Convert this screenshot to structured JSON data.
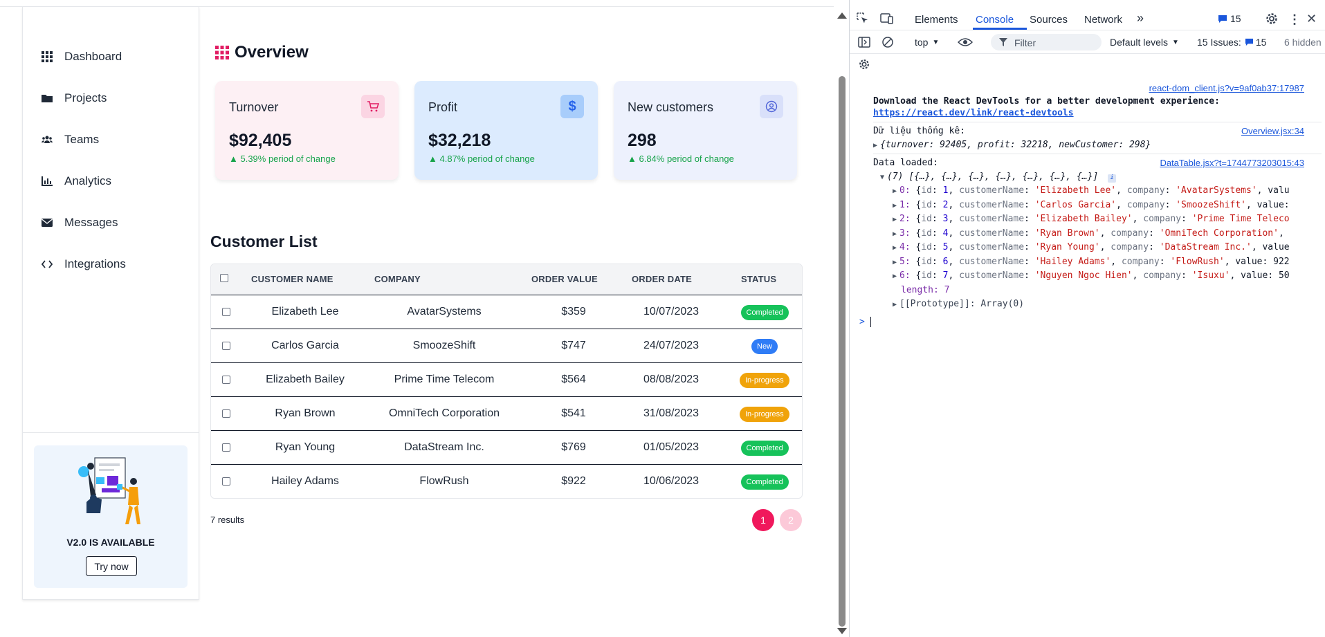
{
  "sidebar": {
    "items": [
      {
        "label": "Dashboard",
        "icon": "grid-icon"
      },
      {
        "label": "Projects",
        "icon": "folder-icon"
      },
      {
        "label": "Teams",
        "icon": "users-icon"
      },
      {
        "label": "Analytics",
        "icon": "chart-icon"
      },
      {
        "label": "Messages",
        "icon": "envelope-icon"
      },
      {
        "label": "Integrations",
        "icon": "code-icon"
      }
    ],
    "promo": {
      "title": "V2.0 IS AVAILABLE",
      "button": "Try now"
    }
  },
  "overview": {
    "title": "Overview",
    "cards": [
      {
        "label": "Turnover",
        "value": "$92,405",
        "change": "▲ 5.39% period of change",
        "icon": "cart-icon",
        "bg": "#fdf0f4",
        "icon_bg": "#fbd5e3",
        "icon_color": "#e11d63"
      },
      {
        "label": "Profit",
        "value": "$32,218",
        "change": "▲ 4.87% period of change",
        "icon": "dollar-icon",
        "bg": "#dcebfe",
        "icon_bg": "#a8cdfb",
        "icon_color": "#2563eb"
      },
      {
        "label": "New customers",
        "value": "298",
        "change": "▲ 6.84% period of change",
        "icon": "user-circle-icon",
        "bg": "#edf1fd",
        "icon_bg": "#d9e0fa",
        "icon_color": "#4f63d8"
      }
    ]
  },
  "customers": {
    "title": "Customer List",
    "columns": [
      "CUSTOMER NAME",
      "COMPANY",
      "ORDER VALUE",
      "ORDER DATE",
      "STATUS"
    ],
    "rows": [
      {
        "name": "Elizabeth Lee",
        "company": "AvatarSystems",
        "value": "$359",
        "date": "10/07/2023",
        "status": "Completed"
      },
      {
        "name": "Carlos Garcia",
        "company": "SmoozeShift",
        "value": "$747",
        "date": "24/07/2023",
        "status": "New"
      },
      {
        "name": "Elizabeth Bailey",
        "company": "Prime Time Telecom",
        "value": "$564",
        "date": "08/08/2023",
        "status": "In-progress"
      },
      {
        "name": "Ryan Brown",
        "company": "OmniTech Corporation",
        "value": "$541",
        "date": "31/08/2023",
        "status": "In-progress"
      },
      {
        "name": "Ryan Young",
        "company": "DataStream Inc.",
        "value": "$769",
        "date": "01/05/2023",
        "status": "Completed"
      },
      {
        "name": "Hailey Adams",
        "company": "FlowRush",
        "value": "$922",
        "date": "10/06/2023",
        "status": "Completed"
      }
    ],
    "status_colors": {
      "Completed": "#16c25a",
      "New": "#2f7cf6",
      "In-progress": "#f0a30a"
    },
    "results": "7 results",
    "pages": [
      "1",
      "2"
    ],
    "active_page": "1"
  },
  "devtools": {
    "tabs": [
      "Elements",
      "Console",
      "Sources",
      "Network"
    ],
    "active_tab": "Console",
    "more_tabs": "»",
    "issues_badge": "15",
    "context": "top",
    "filter_placeholder": "Filter",
    "levels": "Default levels",
    "issues_label": "15 Issues:",
    "issues_count": "15",
    "hidden": "6 hidden",
    "messages": {
      "devtools_link": "react-dom_client.js?v=9af0ab37:17987",
      "devtools_text": "Download the React DevTools for a better development experience:",
      "devtools_url": "https://react.dev/link/react-devtools",
      "stats_label": "Dữ liệu thống kê:",
      "stats_link": "Overview.jsx:34",
      "stats_obj": "{turnover: 92405, profit: 32218, newCustomer: 298}",
      "data_label": "Data loaded:",
      "data_link": "DataTable.jsx?t=1744773203015:43",
      "array_summary": "(7) [{…}, {…}, {…}, {…}, {…}, {…}, {…}]",
      "entries": [
        {
          "idx": "0:",
          "id": "1",
          "name": "'Elizabeth Lee'",
          "company": "'AvatarSystems'",
          "tail": ", valu"
        },
        {
          "idx": "1:",
          "id": "2",
          "name": "'Carlos Garcia'",
          "company": "'SmoozeShift'",
          "tail": ", value:"
        },
        {
          "idx": "2:",
          "id": "3",
          "name": "'Elizabeth Bailey'",
          "company": "'Prime Time Teleco",
          "tail": ""
        },
        {
          "idx": "3:",
          "id": "4",
          "name": "'Ryan Brown'",
          "company": "'OmniTech Corporation'",
          "tail": ","
        },
        {
          "idx": "4:",
          "id": "5",
          "name": "'Ryan Young'",
          "company": "'DataStream Inc.'",
          "tail": ", value"
        },
        {
          "idx": "5:",
          "id": "6",
          "name": "'Hailey Adams'",
          "company": "'FlowRush'",
          "tail": ", value: 922"
        },
        {
          "idx": "6:",
          "id": "7",
          "name": "'Nguyen Ngoc Hien'",
          "company": "'Isuxu'",
          "tail": ", value: 50"
        }
      ],
      "length": "length: 7",
      "prototype": "[[Prototype]]: Array(0)",
      "prompt": ">"
    }
  }
}
